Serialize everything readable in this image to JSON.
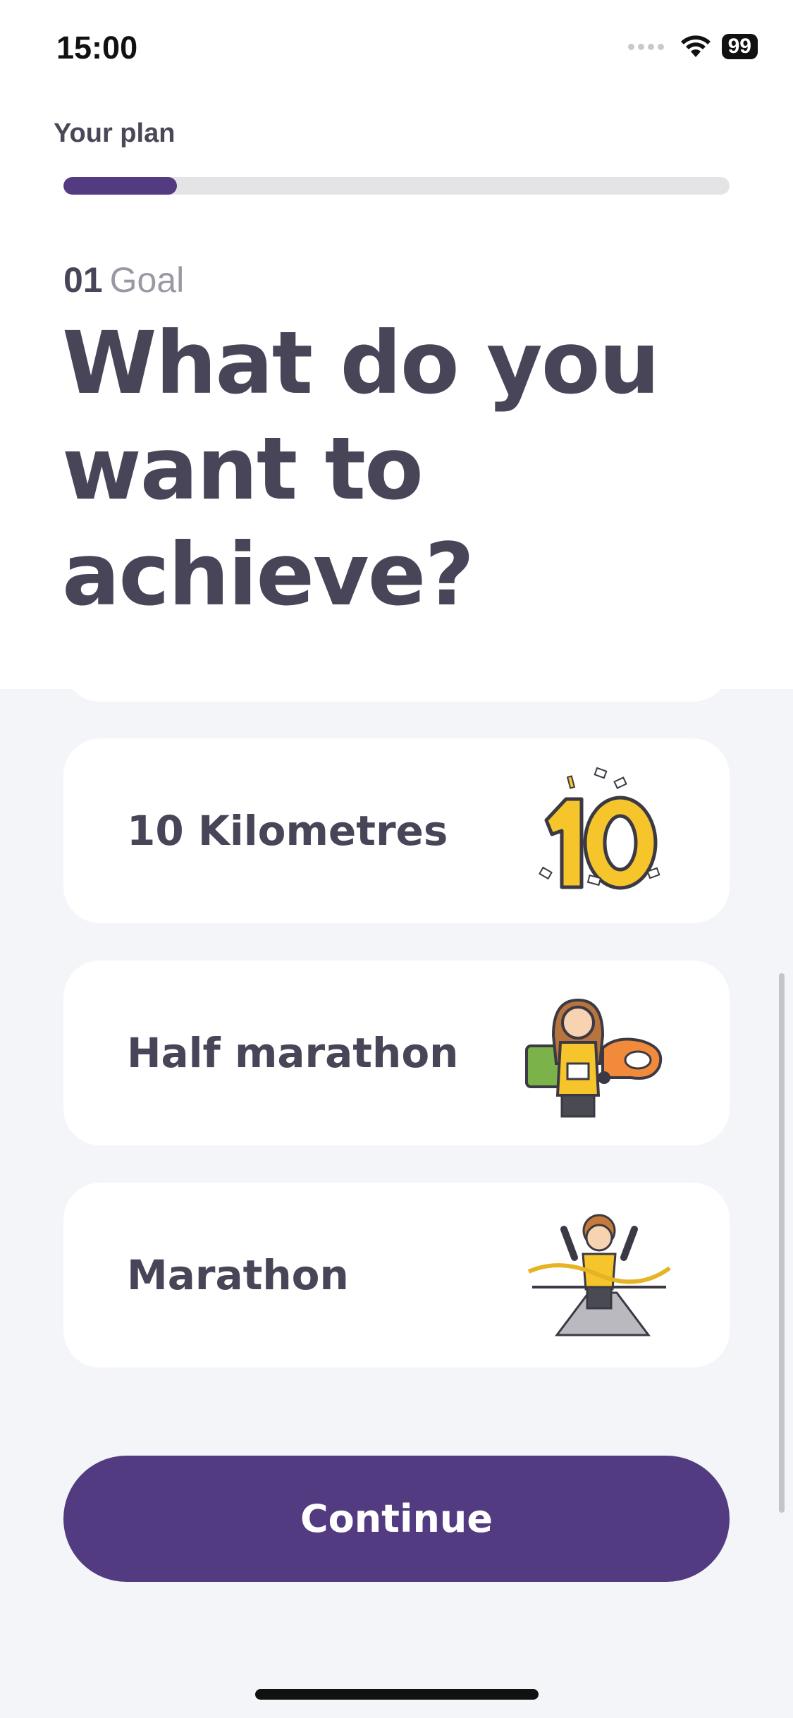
{
  "status_bar": {
    "time": "15:00",
    "battery": "99"
  },
  "plan": {
    "label": "Your plan",
    "progress": 0.17
  },
  "step": {
    "number": "01",
    "label": "Goal"
  },
  "question": {
    "line1": "What do you",
    "line2": "want to",
    "line3": "achieve?"
  },
  "options": [
    {
      "label": "10 Kilometres",
      "icon": "ten-confetti-icon"
    },
    {
      "label": "Half marathon",
      "icon": "runner-medal-icon"
    },
    {
      "label": "Marathon",
      "icon": "finish-line-icon"
    }
  ],
  "continue_label": "Continue",
  "colors": {
    "accent": "#523b80",
    "background": "#f4f5f9",
    "card": "#ffffff",
    "text": "#484558",
    "gold": "#f6c42b"
  }
}
